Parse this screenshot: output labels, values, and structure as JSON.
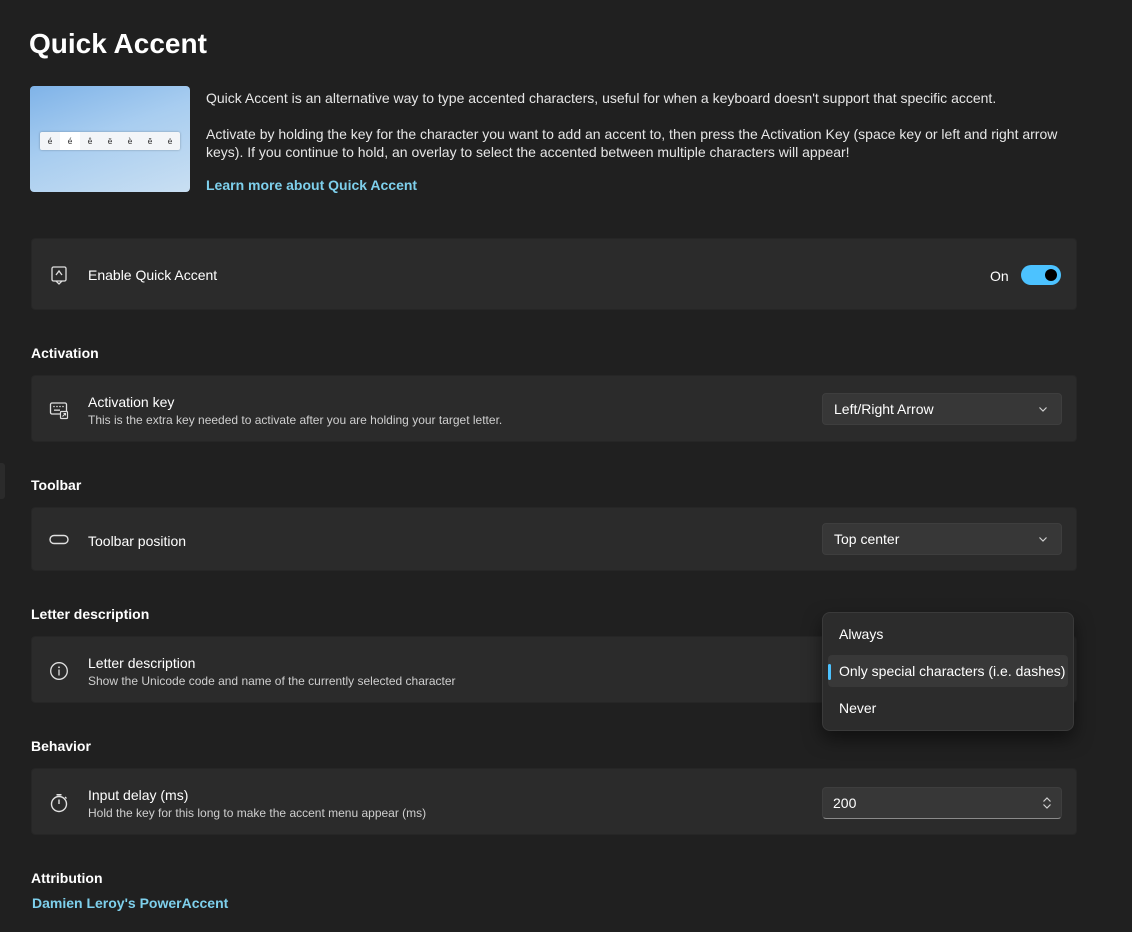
{
  "page": {
    "title": "Quick Accent"
  },
  "intro": {
    "hero_keys": [
      "é",
      "é",
      "ê",
      "ë",
      "è",
      "ē",
      "ė"
    ],
    "description": "Quick Accent is an alternative way to type accented characters, useful for when a keyboard doesn't support that specific accent.",
    "activation_info": "Activate by holding the key for the character you want to add an accent to, then press the Activation Key (space key or left and right arrow keys). If you continue to hold, an overlay to select the accented between multiple characters will appear!",
    "learn_more_link": "Learn more about Quick Accent"
  },
  "enable": {
    "label": "Enable Quick Accent",
    "state_text": "On",
    "enabled": true
  },
  "activation": {
    "header": "Activation",
    "key_title": "Activation key",
    "key_desc": "This is the extra key needed to activate after you are holding your target letter.",
    "key_value": "Left/Right Arrow"
  },
  "toolbar": {
    "header": "Toolbar",
    "position_title": "Toolbar position",
    "position_value": "Top center"
  },
  "letter_description": {
    "header": "Letter description",
    "title": "Letter description",
    "desc": "Show the Unicode code and name of the currently selected character",
    "options": [
      "Always",
      "Only special characters (i.e. dashes)",
      "Never"
    ],
    "selected_index": 1
  },
  "behavior": {
    "header": "Behavior",
    "delay_title": "Input delay (ms)",
    "delay_desc": "Hold the key for this long to make the accent menu appear (ms)",
    "delay_value": "200"
  },
  "attribution": {
    "header": "Attribution",
    "link": "Damien Leroy's PowerAccent"
  },
  "colors": {
    "accent": "#4cc2ff",
    "link": "#7ed0ec",
    "background": "#202020",
    "card": "#2b2b2b"
  }
}
